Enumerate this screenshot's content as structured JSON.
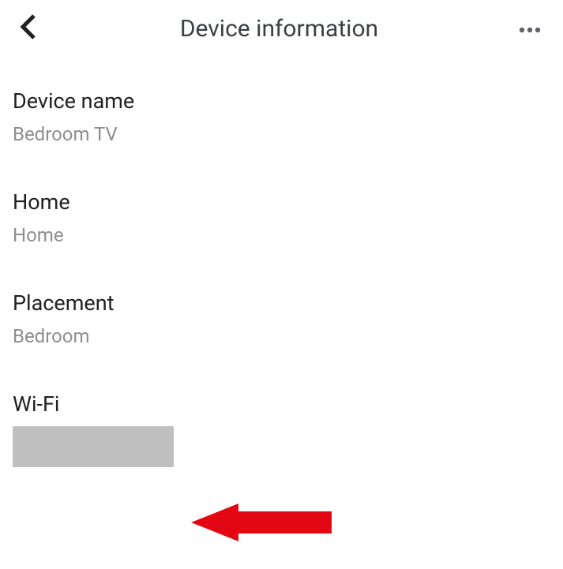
{
  "header": {
    "title": "Device information"
  },
  "rows": {
    "device_name": {
      "label": "Device name",
      "value": "Bedroom  TV"
    },
    "home": {
      "label": "Home",
      "value": "Home"
    },
    "placement": {
      "label": "Placement",
      "value": "Bedroom"
    },
    "wifi": {
      "label": "Wi-Fi"
    }
  }
}
